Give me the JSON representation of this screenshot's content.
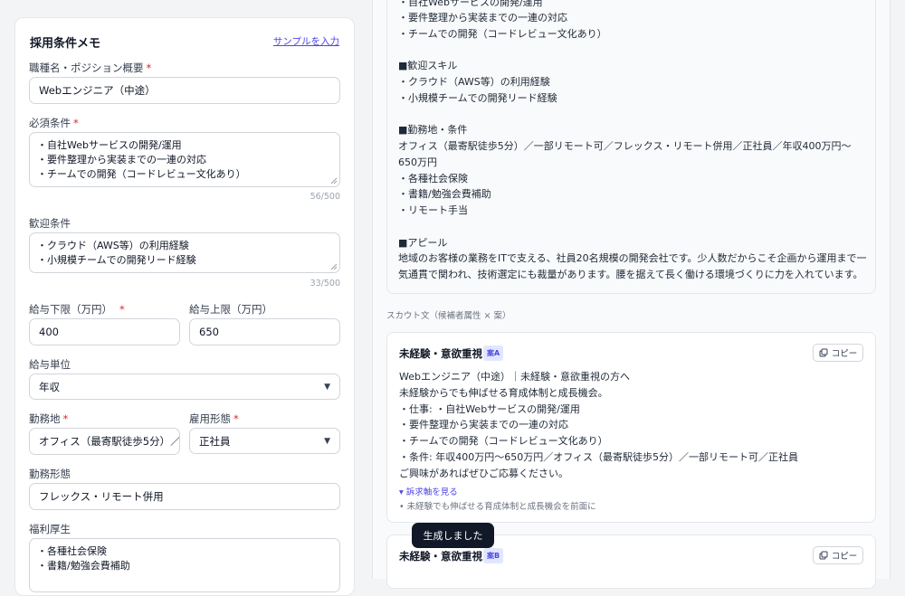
{
  "form": {
    "title": "採用条件メモ",
    "sample_link": "サンプルを入力",
    "job_title": {
      "label": "職種名・ポジション概要",
      "required": "*",
      "value": "Webエンジニア（中途）"
    },
    "requirements": {
      "label": "必須条件",
      "required": "*",
      "lines": [
        "・自社Webサービスの開発/運用",
        "・要件整理から実装までの一連の対応",
        "・チームでの開発（コードレビュー文化あり）"
      ],
      "counter": "56/500"
    },
    "preferred": {
      "label": "歓迎条件",
      "lines": [
        "・クラウド（AWS等）の利用経験",
        "・小規模チームでの開発リード経験"
      ],
      "counter": "33/500"
    },
    "salary_min": {
      "label": "給与下限（万円）",
      "required": "*",
      "value": "400"
    },
    "salary_max": {
      "label": "給与上限（万円）",
      "value": "650"
    },
    "salary_unit": {
      "label": "給与単位",
      "value": "年収"
    },
    "location": {
      "label": "勤務地",
      "required": "*",
      "value": "オフィス（最寄駅徒歩5分）／"
    },
    "employment_type": {
      "label": "雇用形態",
      "required": "*",
      "value": "正社員"
    },
    "work_style": {
      "label": "勤務形態",
      "value": "フレックス・リモート併用"
    },
    "benefits": {
      "label": "福利厚生",
      "lines": [
        "・各種社会保険",
        "・書籍/勉強会費補助"
      ]
    }
  },
  "job_description": {
    "lines": [
      "・自社Webサービスの開発/運用",
      "・要件整理から実装までの一連の対応",
      "・チームでの開発（コードレビュー文化あり）",
      "",
      "■歓迎スキル",
      "・クラウド（AWS等）の利用経験",
      "・小規模チームでの開発リード経験",
      "",
      "■勤務地・条件",
      "オフィス（最寄駅徒歩5分）／一部リモート可／フレックス・リモート併用／正社員／年収400万円〜",
      "650万円",
      "・各種社会保険",
      "・書籍/勉強会費補助",
      "・リモート手当",
      "",
      "■アピール",
      "地域のお客様の業務をITで支える、社員20名規模の開発会社です。少人数だからこそ企画から運用まで一",
      "気通貫で関われ、技術選定にも裁量があります。腰を据えて長く働ける環境づくりに力を入れています。"
    ]
  },
  "scout_section_label": "スカウト文（候補者属性 × 案）",
  "scouts": [
    {
      "title": "未経験・意欲重視",
      "badge": "案A",
      "copy_label": "コピー",
      "lines": [
        "Webエンジニア（中途）｜未経験・意欲重視の方へ",
        "未経験からでも伸ばせる育成体制と成長機会。",
        "・仕事: ・自社Webサービスの開発/運用",
        "・要件整理から実装までの一連の対応",
        "・チームでの開発（コードレビュー文化あり）",
        "・条件: 年収400万円〜650万円／オフィス（最寄駅徒歩5分）／一部リモート可／正社員",
        "ご興味があればぜひご応募ください。"
      ],
      "axis_toggle": "▾ 訴求軸を見る",
      "axis_items": [
        "•  未経験でも伸ばせる育成体制と成長機会を前面に"
      ]
    },
    {
      "title": "未経験・意欲重視",
      "badge": "案B",
      "copy_label": "コピー"
    }
  ],
  "toast": "生成しました"
}
